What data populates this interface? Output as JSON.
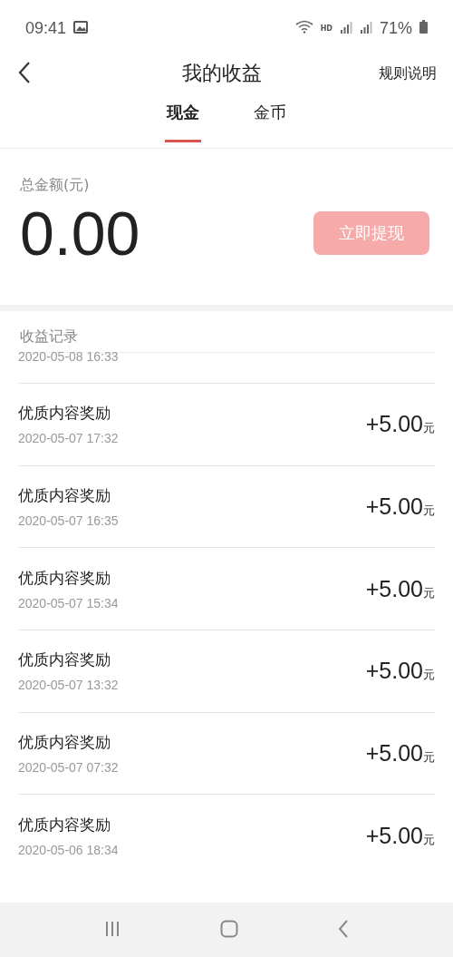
{
  "status_bar": {
    "time": "09:41",
    "network": "HD",
    "battery": "71%"
  },
  "header": {
    "title": "我的收益",
    "action": "规则说明"
  },
  "tabs": [
    {
      "label": "现金",
      "selected": true
    },
    {
      "label": "金币",
      "selected": false
    }
  ],
  "balance": {
    "label": "总金额(元)",
    "amount": "0.00",
    "button": {
      "label": "立即提现",
      "disabled": true
    }
  },
  "records": {
    "title": "收益记录",
    "partial_date": "2020-05-08 16:33",
    "items": [
      {
        "title": "优质内容奖励",
        "date": "2020-05-07 17:32",
        "amount": "+5.00",
        "unit": "元"
      },
      {
        "title": "优质内容奖励",
        "date": "2020-05-07 16:35",
        "amount": "+5.00",
        "unit": "元"
      },
      {
        "title": "优质内容奖励",
        "date": "2020-05-07 15:34",
        "amount": "+5.00",
        "unit": "元"
      },
      {
        "title": "优质内容奖励",
        "date": "2020-05-07 13:32",
        "amount": "+5.00",
        "unit": "元"
      },
      {
        "title": "优质内容奖励",
        "date": "2020-05-07 07:32",
        "amount": "+5.00",
        "unit": "元"
      },
      {
        "title": "优质内容奖励",
        "date": "2020-05-06 18:34",
        "amount": "+5.00",
        "unit": "元"
      }
    ]
  }
}
